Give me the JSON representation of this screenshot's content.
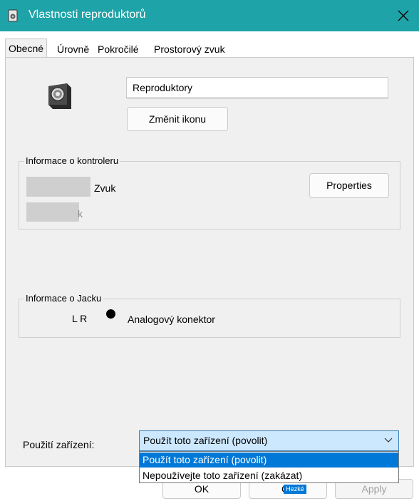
{
  "window": {
    "title": "Vlastnosti reproduktorů",
    "title_icon": "speaker-icon",
    "close_icon": "close-icon",
    "accent_color": "#1ea3a8"
  },
  "tabs": [
    {
      "label": "Obecné",
      "active": true
    },
    {
      "label": "Úrovně",
      "active": false
    },
    {
      "label": "Pokročilé",
      "active": false
    },
    {
      "label": "Prostorový zvuk",
      "active": false
    }
  ],
  "general": {
    "device_name_value": "Reproduktory",
    "change_icon_label": "Změnit ikonu"
  },
  "controller": {
    "group_label": "Informace o kontroleru",
    "line1_visible_suffix": "Zvuk",
    "line2_visible_suffix": "k",
    "properties_label": "Properties"
  },
  "jack": {
    "group_label": "Informace o Jacku",
    "channels": "L R",
    "connector_label": "Analogový konektor"
  },
  "usage": {
    "label": "Použití zařízení:",
    "selected": "Použít toto zařízení (povolit)",
    "options": [
      "Použít toto zařízení (povolit)",
      "Nepoužívejte toto zařízení (zakázat)"
    ]
  },
  "footer": {
    "ok_label": "OK",
    "cancel_label": "Ca",
    "apply_label": "Apply",
    "tooltip_text": "Hezké"
  }
}
